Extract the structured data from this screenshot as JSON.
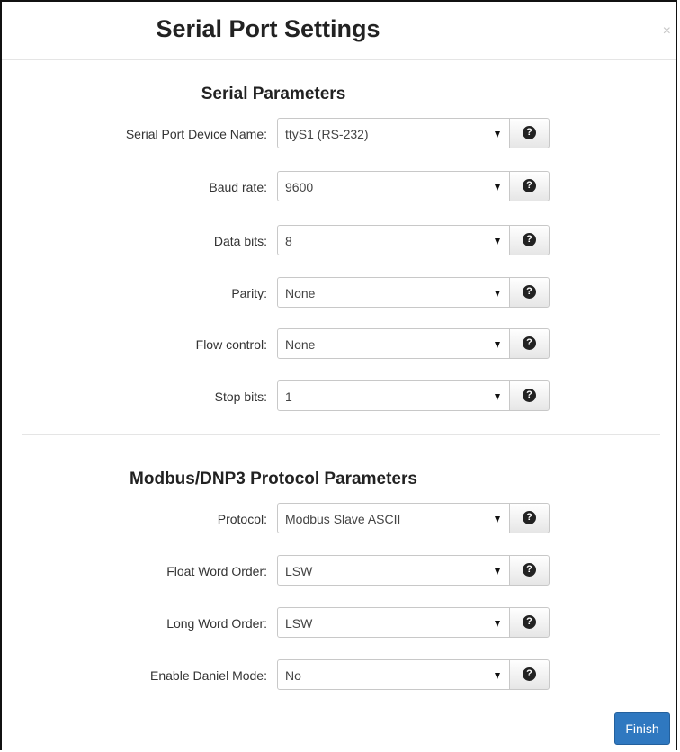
{
  "dialog": {
    "title": "Serial Port Settings",
    "close_glyph": "×"
  },
  "serial_section": {
    "title": "Serial Parameters",
    "fields": [
      {
        "label": "Serial Port Device Name:",
        "value": "ttyS1 (RS-232)"
      },
      {
        "label": "Baud rate:",
        "value": "9600"
      },
      {
        "label": "Data bits:",
        "value": "8"
      },
      {
        "label": "Parity:",
        "value": "None"
      },
      {
        "label": "Flow control:",
        "value": "None"
      },
      {
        "label": "Stop bits:",
        "value": "1"
      }
    ]
  },
  "protocol_section": {
    "title": "Modbus/DNP3 Protocol Parameters",
    "fields": [
      {
        "label": "Protocol:",
        "value": "Modbus Slave ASCII"
      },
      {
        "label": "Float Word Order:",
        "value": "LSW"
      },
      {
        "label": "Long Word Order:",
        "value": "LSW"
      },
      {
        "label": "Enable Daniel Mode:",
        "value": "No"
      }
    ]
  },
  "help": {
    "icon": "question-circle-icon",
    "glyph": "?"
  },
  "finish_label": "Finish",
  "colors": {
    "primary": "#2f78c0"
  }
}
